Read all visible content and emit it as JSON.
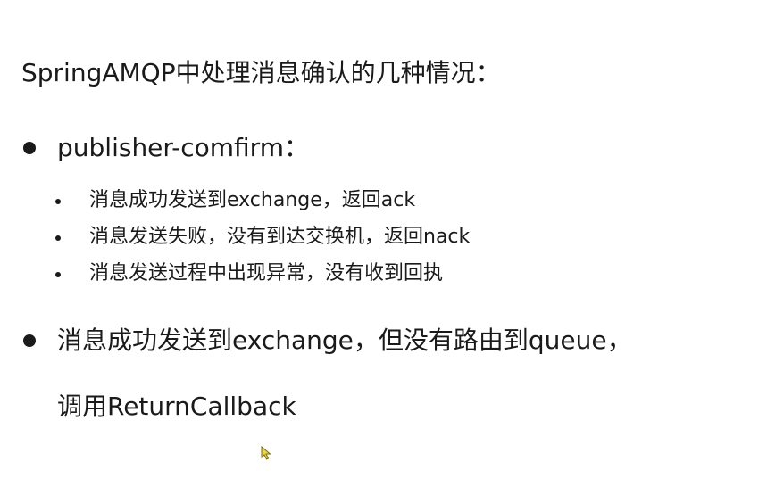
{
  "title": "SpringAMQP中处理消息确认的几种情况：",
  "bullets": [
    {
      "text": "publisher-comfirm：",
      "sub_items": [
        "消息成功发送到exchange，返回ack",
        "消息发送失败，没有到达交换机，返回nack",
        "消息发送过程中出现异常，没有收到回执"
      ]
    },
    {
      "text": "消息成功发送到exchange，但没有路由到queue，",
      "continuation": "调用ReturnCallback"
    }
  ],
  "icons": {
    "cursor": "mouse-pointer-icon",
    "cursor_color": "#e8d84a"
  }
}
